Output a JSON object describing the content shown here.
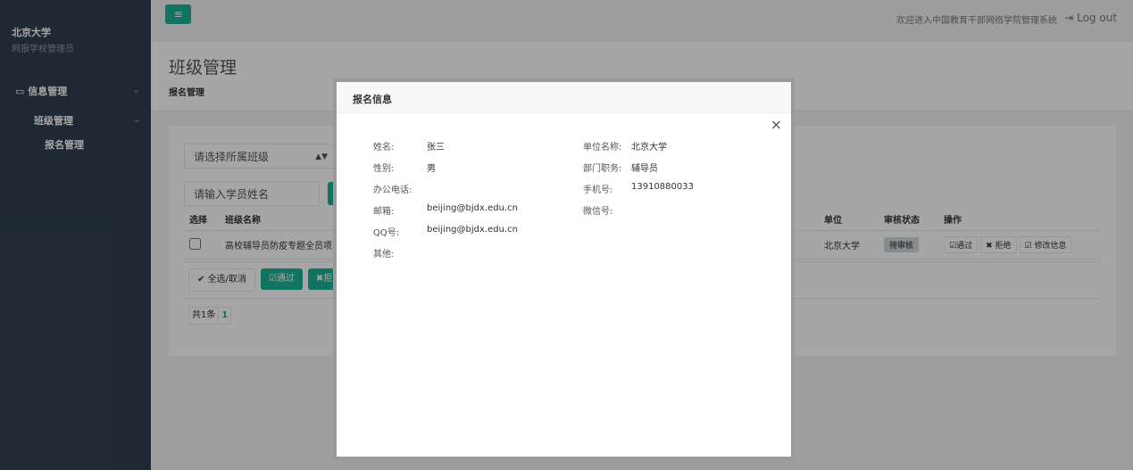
{
  "sidebar": {
    "university": "北京大学",
    "role": "网报学校管理员",
    "menu_info": "信息管理",
    "menu_class": "班级管理",
    "menu_signup": "报名管理"
  },
  "topbar": {
    "menu_icon": "≡",
    "welcome": "欢迎进入中国教育干部网络学院管理系统",
    "logout": "Log out"
  },
  "page": {
    "title": "班级管理",
    "breadcrumb": "报名管理"
  },
  "filters": {
    "class_select": "请选择所属班级",
    "name_placeholder": "请输入学员姓名"
  },
  "table": {
    "headers": {
      "select": "选择",
      "class_name": "班级名称",
      "unit": "单位",
      "status": "审核状态",
      "ops": "操作"
    },
    "rows": [
      {
        "class_name": "高校辅导员防疫专题全员项",
        "unit": "北京大学",
        "status": "待审核",
        "op_pass": "通过",
        "op_reject": "拒绝",
        "op_edit": "修改信息"
      }
    ]
  },
  "actions": {
    "select_all": "全选/取消",
    "pass": "通过",
    "reject_partial": "拒"
  },
  "pager": {
    "total": "共1条",
    "page": "1"
  },
  "modal": {
    "title": "报名信息",
    "close": "×",
    "name_label": "姓名:",
    "name_value": "张三",
    "gender_label": "性别:",
    "gender_value": "男",
    "office_phone_label": "办公电话:",
    "email_label": "邮箱:",
    "email_value": "beijing@bjdx.edu.cn",
    "qq_label": "QQ号:",
    "qq_value": "beijing@bjdx.edu.cn",
    "other_label": "其他:",
    "unit_label": "单位名称:",
    "unit_value": "北京大学",
    "dept_label": "部门职务:",
    "dept_value": "辅导员",
    "mobile_label": "手机号:",
    "mobile_value": "13910880033",
    "wechat_label": "微信号:"
  },
  "colors": {
    "sidebar": "#2f4050",
    "accent": "#1ab394"
  }
}
